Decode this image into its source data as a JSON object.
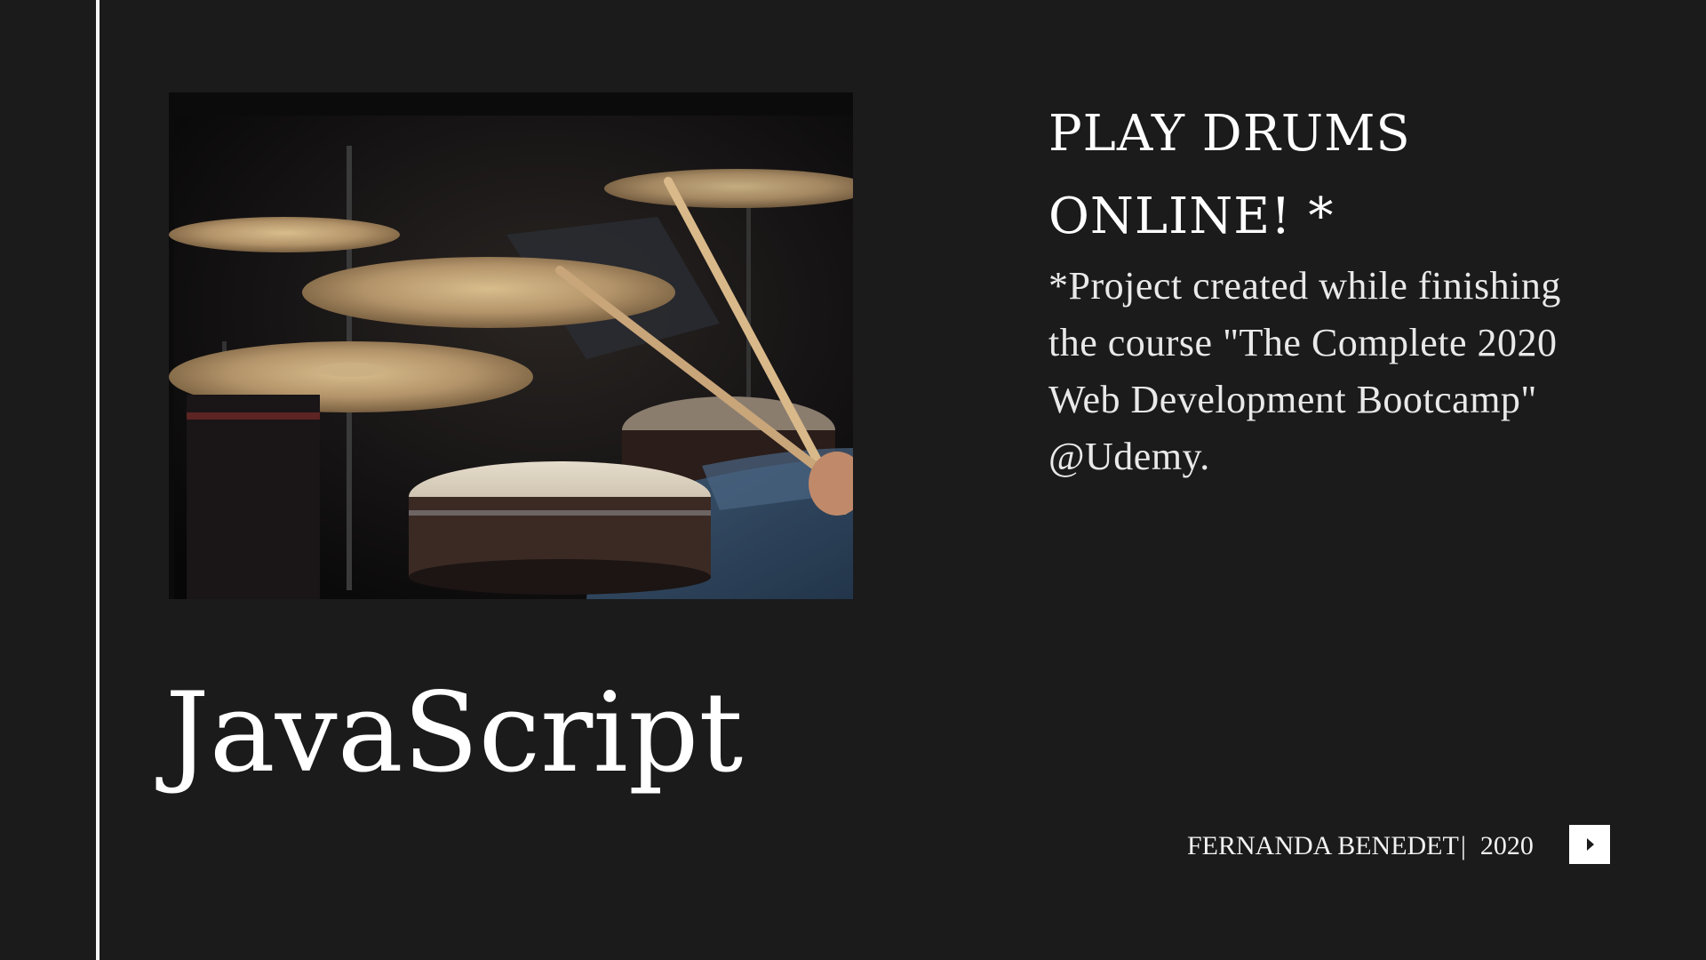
{
  "slide": {
    "title_line1": "PLAY DRUMS",
    "title_line2": "ONLINE!  *",
    "description_line1": "*Project created while finishing",
    "description_line2": "the course \"The Complete 2020",
    "description_line3": "Web Development Bootcamp\"",
    "description_line4": "@Udemy.",
    "big_word": "JavaScript",
    "author": "FERNANDA BENEDET",
    "separator": "|",
    "year": "2020"
  },
  "image": {
    "subject": "drum kit with cymbals and drumsticks",
    "icon": "drums-photo"
  },
  "controls": {
    "next_icon": "play-triangle-icon"
  },
  "colors": {
    "background": "#1b1b1c",
    "text": "#ffffff",
    "rule": "#f4f4f4"
  }
}
